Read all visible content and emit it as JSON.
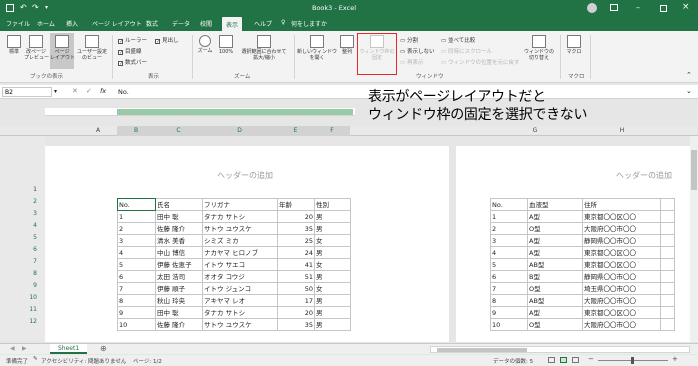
{
  "titlebar": {
    "title": "Book3 - Excel",
    "save_icon": "save-icon",
    "undo_icon": "undo-icon",
    "redo_icon": "redo-icon"
  },
  "tabs": [
    "ファイル",
    "ホーム",
    "挿入",
    "ページ レイアウト",
    "数式",
    "データ",
    "校閲",
    "表示",
    "ヘルプ"
  ],
  "tell_me": "何をしますか",
  "ribbon": {
    "view_buttons": [
      "標準",
      "改ページ\nプレビュー",
      "ページ\nレイアウト",
      "ユーザー設定\nのビュー"
    ],
    "group_book_view": "ブックの表示",
    "show_checks": [
      "ルーラー",
      "目盛線",
      "数式バー",
      "見出し"
    ],
    "group_show": "表示",
    "zoom_buttons": [
      "ズーム",
      "100%",
      "選択範囲に合わせて\n拡大/縮小"
    ],
    "group_zoom": "ズーム",
    "window_buttons": [
      "新しいウィンドウ\nを開く",
      "整列",
      "ウィンドウ枠の\n固定"
    ],
    "window_small_left": [
      "分割",
      "表示しない",
      "再表示"
    ],
    "window_small_right": [
      "並べて比較",
      "同時にスクロール",
      "ウィンドウの位置を元に戻す"
    ],
    "switch_window": "ウィンドウの\n切り替え",
    "group_window": "ウィンドウ",
    "macro": "マクロ",
    "group_macro": "マクロ"
  },
  "formula_bar": {
    "name_box": "B2",
    "fx": "fx",
    "value": "No."
  },
  "annotation": {
    "line1": "表示がページレイアウトだと",
    "line2": "ウィンドウ枠の固定を選択できない"
  },
  "columns_left": [
    "A",
    "B",
    "C",
    "D",
    "E",
    "F"
  ],
  "columns_right": [
    "G",
    "H"
  ],
  "rows": [
    "1",
    "2",
    "3",
    "4",
    "5",
    "6",
    "7",
    "8",
    "9",
    "10",
    "11",
    "12"
  ],
  "header_placeholder": "ヘッダーの追加",
  "table_left": {
    "headers": [
      "No.",
      "氏名",
      "フリガナ",
      "年齢",
      "性別"
    ],
    "rows": [
      [
        "1",
        "田中 聡",
        "タナカ サトシ",
        "20",
        "男"
      ],
      [
        "2",
        "佐藤 隆介",
        "サトウ ユウスケ",
        "35",
        "男"
      ],
      [
        "3",
        "清水 美香",
        "シミズ ミカ",
        "25",
        "女"
      ],
      [
        "4",
        "中山 博信",
        "ナカヤマ ヒロノブ",
        "24",
        "男"
      ],
      [
        "5",
        "伊藤 佐恵子",
        "イトウ サエコ",
        "41",
        "女"
      ],
      [
        "6",
        "太田 浩司",
        "オオタ コウジ",
        "51",
        "男"
      ],
      [
        "7",
        "伊藤 順子",
        "イトウ ジュンコ",
        "50",
        "女"
      ],
      [
        "8",
        "秋山 玲央",
        "アキヤマ レオ",
        "17",
        "男"
      ],
      [
        "9",
        "田中 聡",
        "タナカ サトシ",
        "20",
        "男"
      ],
      [
        "10",
        "佐藤 隆介",
        "サトウ ユウスケ",
        "35",
        "男"
      ]
    ]
  },
  "table_right": {
    "headers": [
      "No.",
      "血液型",
      "住所"
    ],
    "rows": [
      [
        "1",
        "A型",
        "東京都〇〇区〇〇"
      ],
      [
        "2",
        "O型",
        "大阪府〇〇市〇〇"
      ],
      [
        "3",
        "A型",
        "静岡県〇〇市〇〇"
      ],
      [
        "4",
        "A型",
        "東京都〇〇区〇〇"
      ],
      [
        "5",
        "AB型",
        "東京都〇〇区〇〇"
      ],
      [
        "6",
        "B型",
        "静岡県〇〇市〇〇"
      ],
      [
        "7",
        "O型",
        "埼玉県〇〇市〇〇"
      ],
      [
        "8",
        "AB型",
        "大阪府〇〇市〇〇"
      ],
      [
        "9",
        "A型",
        "東京都〇〇区〇〇"
      ],
      [
        "10",
        "O型",
        "大阪府〇〇市〇〇"
      ]
    ]
  },
  "sheet_tab": "Sheet1",
  "status": {
    "ready": "準備完了",
    "accessibility": "アクセシビリティ: 問題ありません",
    "page": "ページ: 1/2",
    "count": "データの個数: 5"
  },
  "colors": {
    "accent": "#217346",
    "highlight_box": "#e0282e"
  }
}
